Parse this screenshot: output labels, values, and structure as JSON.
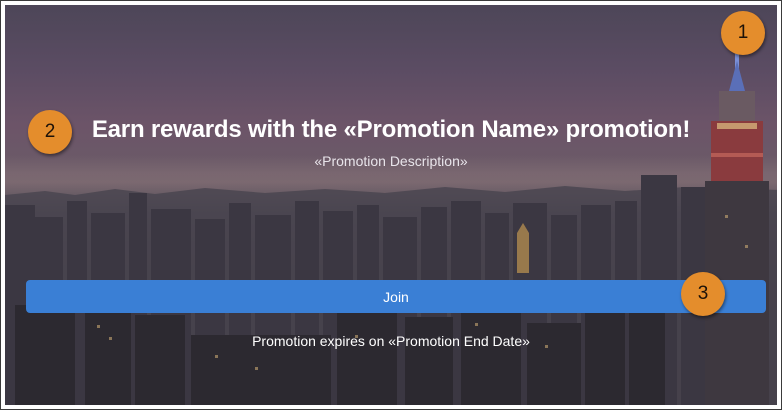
{
  "promo": {
    "title": "Earn rewards with the «Promotion Name» promotion!",
    "description": "«Promotion Description»",
    "join_label": "Join",
    "expiry_text": "Promotion expires on «Promotion End Date»"
  },
  "callouts": [
    "1",
    "2",
    "3"
  ],
  "colors": {
    "button": "#3a7fd5",
    "callout": "#e48d2c"
  }
}
